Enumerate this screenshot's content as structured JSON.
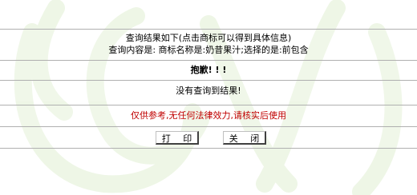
{
  "header": {
    "line1": "查询结果如下(点击商标可以得到具体信息)",
    "line2": "查询内容是: 商标名称是:奶昔果汁;选择的是:前包含"
  },
  "message": {
    "sorry": "抱歉! ! !",
    "no_result": "没有查询到结果!"
  },
  "disclaimer": "仅供参考,无任何法律效力,请核实后使用",
  "buttons": {
    "print_label": "打 印",
    "close_label": "关 闭"
  },
  "colors": {
    "disclaimer": "#c00000",
    "watermark": "#eef6e6"
  }
}
